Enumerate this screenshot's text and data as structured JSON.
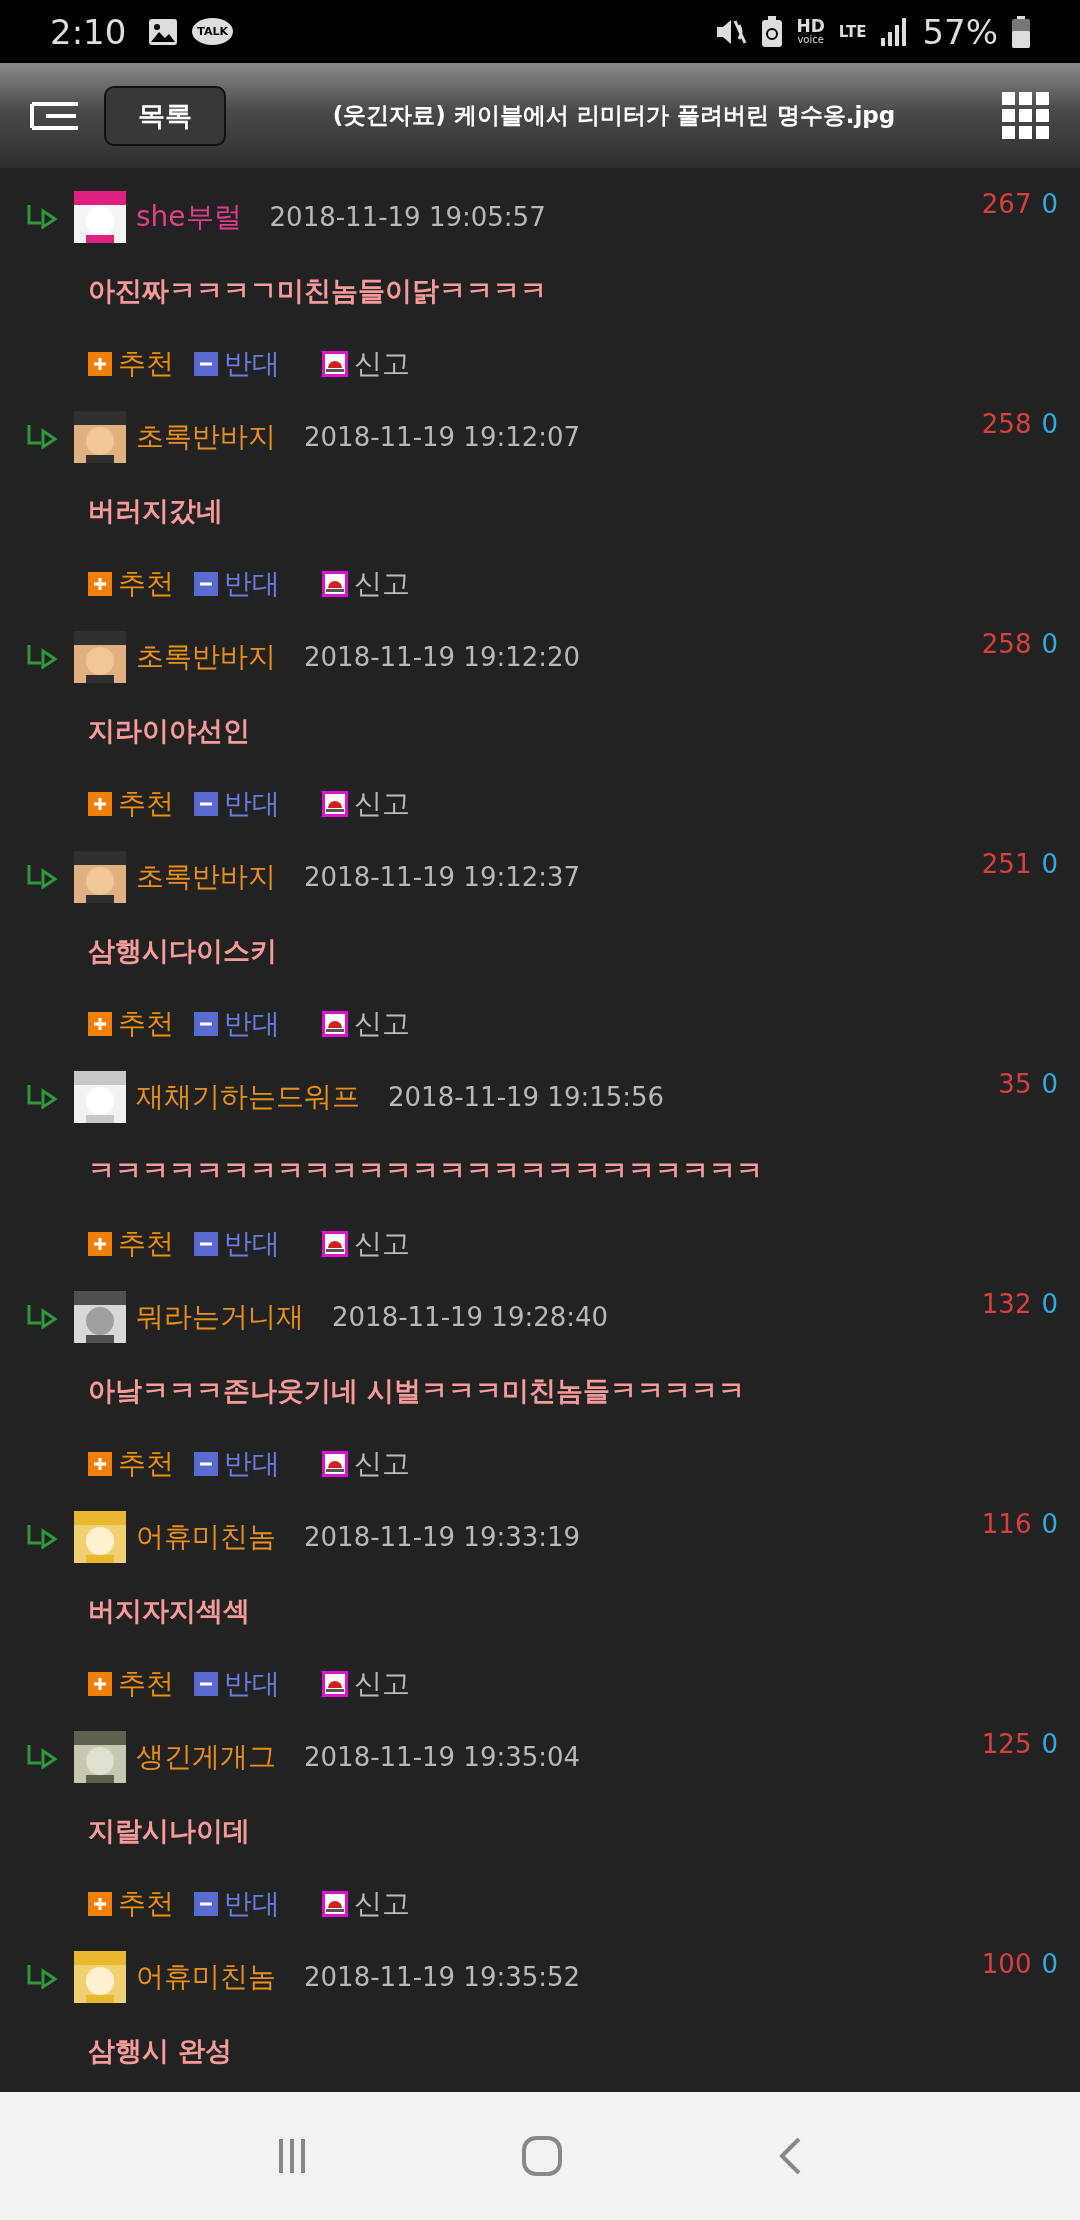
{
  "status_bar": {
    "time": "2:10",
    "talk_badge": "TALK",
    "hd": "HD",
    "voice": "voice",
    "network": "LTE",
    "battery": "57%"
  },
  "header": {
    "list_button": "목록",
    "title": "(웃긴자료) 케이블에서 리미터가 풀려버린 명수옹.jpg"
  },
  "comments": [
    {
      "author": "she부럴",
      "color": "#e0408a",
      "date": "2018-11-19 19:05:57",
      "up": "267",
      "down": "0",
      "text": "아진짜ㅋㅋㅋㄱ미친놈들이닭ㅋㅋㅋㅋ",
      "actions": [
        {
          "kind": "up",
          "label": "추천"
        },
        {
          "kind": "down",
          "label": "반대"
        },
        {
          "kind": "report",
          "label": "신고"
        }
      ]
    },
    {
      "author": "초록반바지",
      "color": "#e8901a",
      "date": "2018-11-19 19:12:07",
      "up": "258",
      "down": "0",
      "text": "버러지갔네",
      "actions": [
        {
          "kind": "up",
          "label": "추천"
        },
        {
          "kind": "down",
          "label": "반대"
        },
        {
          "kind": "report",
          "label": "신고"
        }
      ]
    },
    {
      "author": "초록반바지",
      "color": "#e8901a",
      "date": "2018-11-19 19:12:20",
      "up": "258",
      "down": "0",
      "text": "지라이야선인",
      "actions": [
        {
          "kind": "up",
          "label": "추천"
        },
        {
          "kind": "down",
          "label": "반대"
        },
        {
          "kind": "report",
          "label": "신고"
        }
      ]
    },
    {
      "author": "초록반바지",
      "color": "#e8901a",
      "date": "2018-11-19 19:12:37",
      "up": "251",
      "down": "0",
      "text": "삼행시다이스키",
      "actions": [
        {
          "kind": "up",
          "label": "추천"
        },
        {
          "kind": "down",
          "label": "반대"
        },
        {
          "kind": "report",
          "label": "신고"
        }
      ]
    },
    {
      "author": "재채기하는드워프",
      "color": "#e8901a",
      "date": "2018-11-19 19:15:56",
      "up": "35",
      "down": "0",
      "text": "ㅋㅋㅋㅋㅋㅋㅋㅋㅋㅋㅋㅋㅋㅋㅋㅋㅋㅋㅋㅋㅋㅋㅋㅋㅋ",
      "actions": [
        {
          "kind": "up",
          "label": "추천"
        },
        {
          "kind": "down",
          "label": "반대"
        },
        {
          "kind": "report",
          "label": "신고"
        }
      ]
    },
    {
      "author": "뭐라는거니재",
      "color": "#e8901a",
      "date": "2018-11-19 19:28:40",
      "up": "132",
      "down": "0",
      "text": "아낰ㅋㅋㅋ존나웃기네 시벌ㅋㅋㅋ미친놈들ㅋㅋㅋㅋㅋ",
      "actions": [
        {
          "kind": "up",
          "label": "추천"
        },
        {
          "kind": "down",
          "label": "반대"
        },
        {
          "kind": "report",
          "label": "신고"
        }
      ]
    },
    {
      "author": "어휴미친놈",
      "color": "#e8901a",
      "date": "2018-11-19 19:33:19",
      "up": "116",
      "down": "0",
      "text": "버지자지섹섹",
      "actions": [
        {
          "kind": "up",
          "label": "추천"
        },
        {
          "kind": "down",
          "label": "반대"
        },
        {
          "kind": "report",
          "label": "신고"
        }
      ]
    },
    {
      "author": "생긴게개그",
      "color": "#e8901a",
      "date": "2018-11-19 19:35:04",
      "up": "125",
      "down": "0",
      "text": "지랄시나이데",
      "actions": [
        {
          "kind": "up",
          "label": "추천"
        },
        {
          "kind": "down",
          "label": "반대"
        },
        {
          "kind": "report",
          "label": "신고"
        }
      ]
    },
    {
      "author": "어휴미친놈",
      "color": "#e8901a",
      "date": "2018-11-19 19:35:52",
      "up": "100",
      "down": "0",
      "text": "삼행시 완성"
    }
  ]
}
